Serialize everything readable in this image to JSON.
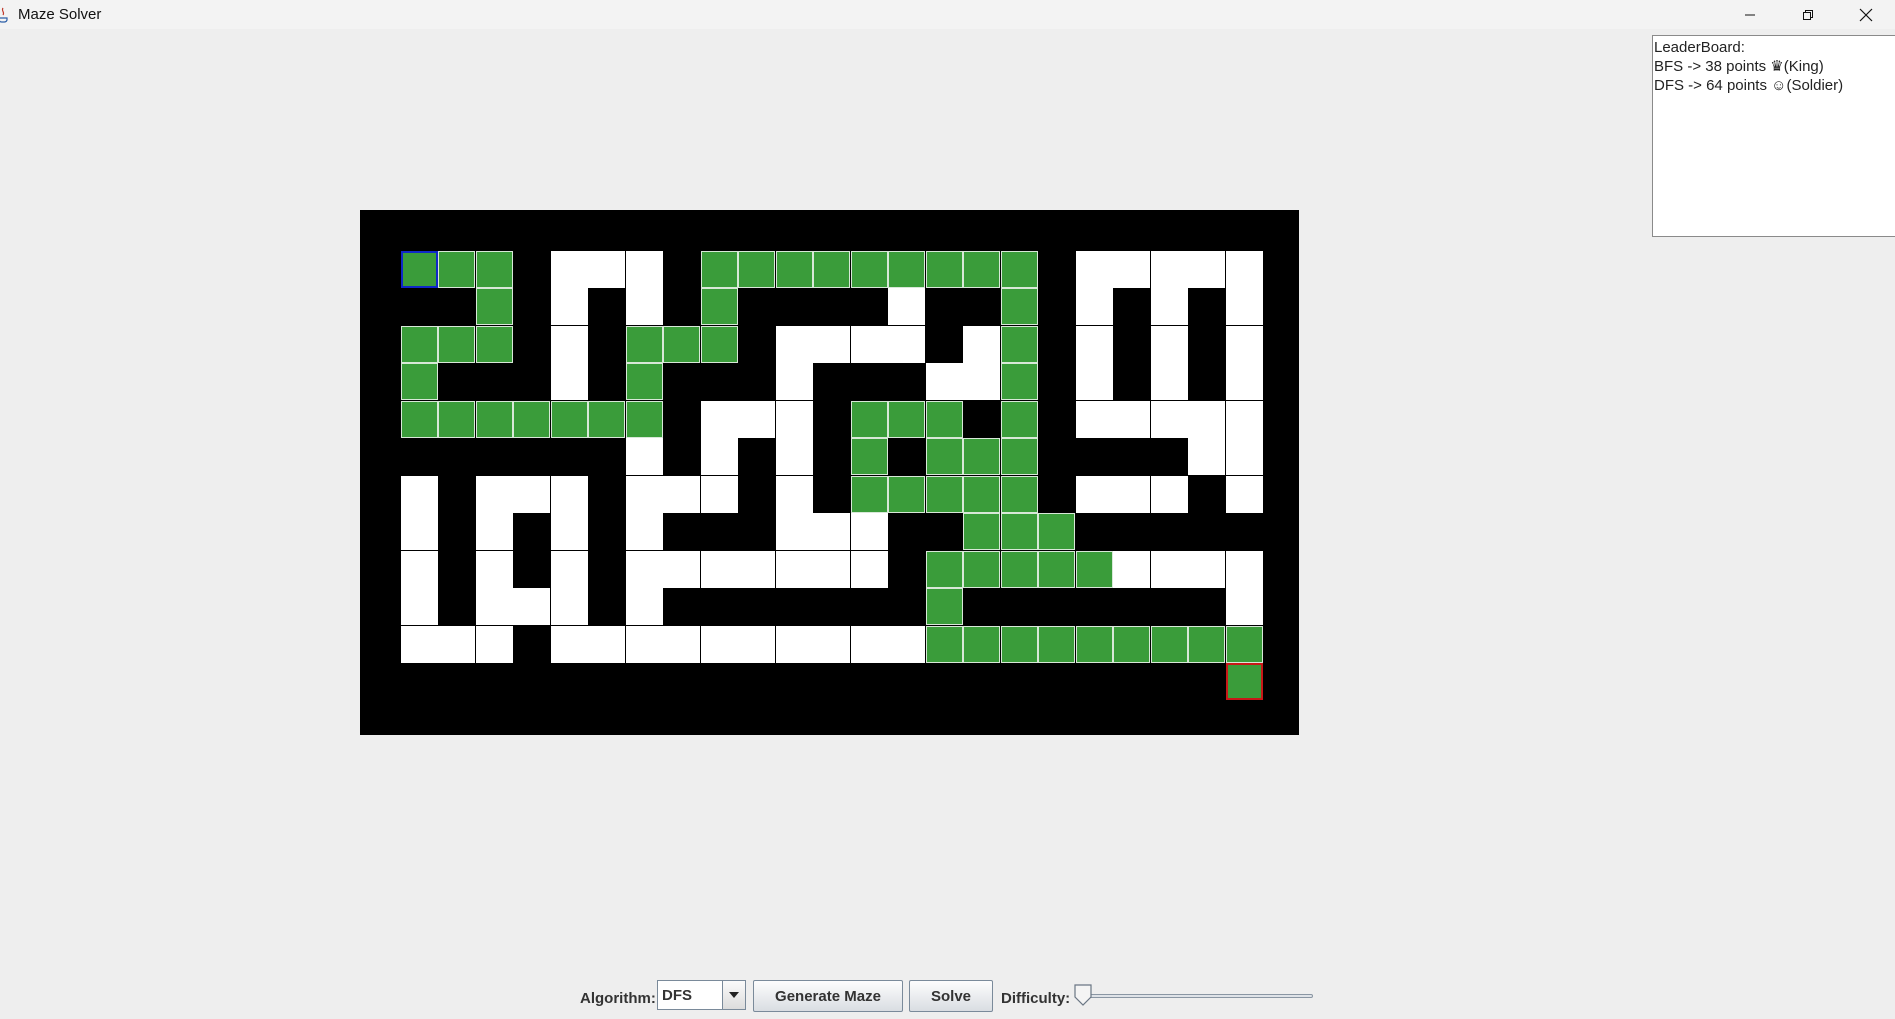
{
  "window": {
    "title": "Maze Solver"
  },
  "leaderboard": {
    "title": "LeaderBoard:",
    "entries": [
      {
        "text": "BFS -> 38 points ♛(King)"
      },
      {
        "text": "DFS -> 64 points ☺(Soldier)"
      }
    ]
  },
  "maze": {
    "colors": {
      "wall": "#000000",
      "open": "#ffffff",
      "path": "#3a9c3a",
      "start_border": "#1028c8",
      "end_border": "#c81818"
    },
    "legend": {
      "0": "wall",
      "1": "open",
      "2": "path"
    },
    "grid": [
      "0000000000000000000000000",
      "0222011102222222220111110",
      "0002010102000010020101010",
      "0222010222011110120101010",
      "0200010200010001120101010",
      "0222222201110222020111110",
      "0000000101010202220000110",
      "0101110111010222220111010",
      "0101010100011100222000000",
      "0101010111111102222211110",
      "0101110100000002000000010",
      "0111011111111112222222220",
      "0000000000000000000000020",
      "0000000000000000000000000"
    ],
    "start": {
      "row": 1,
      "col": 1
    },
    "end": {
      "row": 12,
      "col": 23
    }
  },
  "controls": {
    "algorithm_label": "Algorithm:",
    "algorithm_value": "DFS",
    "generate_label": "Generate Maze",
    "solve_label": "Solve",
    "difficulty_label": "Difficulty:",
    "difficulty_value": 0
  }
}
